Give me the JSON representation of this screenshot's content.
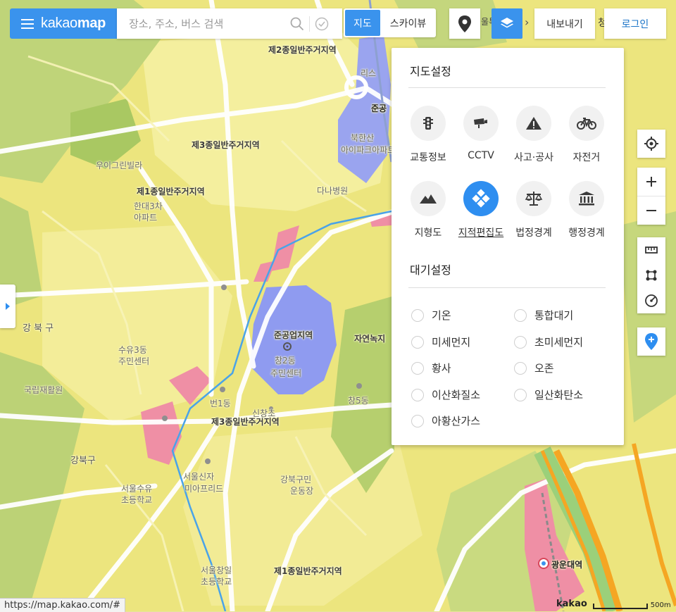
{
  "app": {
    "brand_light": "kakao",
    "brand_bold": "map",
    "search_placeholder": "장소, 주소, 버스 검색",
    "map_toggle": [
      "지도",
      "스카이뷰"
    ],
    "map_toggle_active": "지도",
    "export_label": "내보내기",
    "partial_label": "청",
    "login_label": "로그인",
    "roadview_partial": "울특"
  },
  "colors": {
    "accent": "#3a93ed",
    "zone_yellow": "#f2ea8c",
    "zone_green": "#c8d97a",
    "zone_blue": "#8f9bf0",
    "zone_pink": "#ef8fa5",
    "road_blue": "#4aa3e8",
    "expressway": "#f5a623"
  },
  "panel": {
    "map_settings_title": "지도설정",
    "map_options": [
      {
        "label": "교통정보",
        "icon": "traffic-light-icon",
        "active": false
      },
      {
        "label": "CCTV",
        "icon": "cctv-icon",
        "active": false
      },
      {
        "label": "사고·공사",
        "icon": "warning-icon",
        "active": false
      },
      {
        "label": "자전거",
        "icon": "bicycle-icon",
        "active": false
      },
      {
        "label": "지형도",
        "icon": "mountain-icon",
        "active": false
      },
      {
        "label": "지적편집도",
        "icon": "cadastral-icon",
        "active": true
      },
      {
        "label": "법정경계",
        "icon": "scales-icon",
        "active": false
      },
      {
        "label": "행정경계",
        "icon": "government-building-icon",
        "active": false
      }
    ],
    "air_settings_title": "대기설정",
    "air_options": [
      "기온",
      "통합대기",
      "미세먼지",
      "초미세먼지",
      "황사",
      "오존",
      "이산화질소",
      "일산화탄소",
      "아황산가스"
    ]
  },
  "map_labels": {
    "zone1": "제2종일반주거지역",
    "zone2": "제3종일반주거지역",
    "zone3": "제1종일반주거지역",
    "zone4": "준공업지역",
    "zone5": "제3종일반주거지역",
    "zone6": "제1종일반주거지역",
    "zone7": "자연녹지",
    "district": "강 북 구",
    "district2": "강북구",
    "dong": "창2동",
    "dong_center": "주민센터",
    "station1": "광운대역",
    "apt1": "북한산",
    "apt2": "아이파크아파트",
    "apt3": "우이그린빌라",
    "apt4": "한대3차",
    "apt5": "아파트",
    "school1": "서울수유",
    "school2": "초등학교",
    "misc1": "국립재활원",
    "misc2": "창5동",
    "misc3": "번1동",
    "misc4": "서울신자",
    "misc5": "신창초",
    "misc6": "서울창일",
    "misc7": "초등학교",
    "misc8": "수유3동",
    "misc9": "주민센터",
    "misc10": "준공",
    "misc11": "리스",
    "misc12": "다나병원",
    "misc13": "미아프리드",
    "misc14": "강북구민",
    "misc15": "운동장"
  },
  "status": {
    "url": "https://map.kakao.com/#",
    "scale_brand": "kakao",
    "scale_label": "500m"
  }
}
